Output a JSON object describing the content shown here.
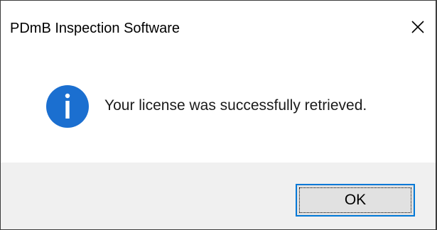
{
  "dialog": {
    "title": "PDmB Inspection Software",
    "message": "Your license was successfully retrieved.",
    "icon": "info-icon",
    "ok_label": "OK",
    "close_icon": "close-icon"
  },
  "colors": {
    "info_icon_bg": "#1b6fd0",
    "accent_border": "#0078d7",
    "footer_bg": "#f0f0f0",
    "button_bg": "#e1e1e1"
  }
}
